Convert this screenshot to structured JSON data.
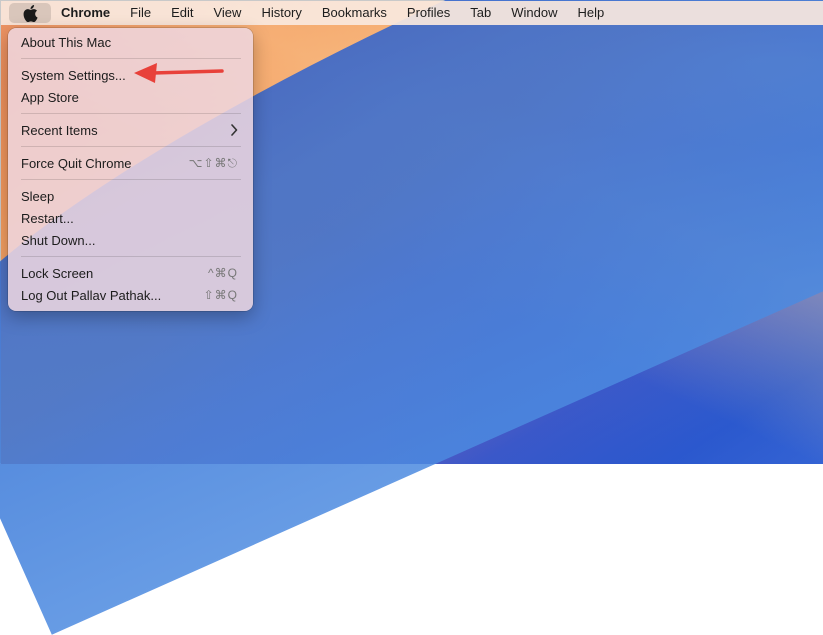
{
  "menubar": {
    "apple_icon": "apple-icon",
    "items": [
      "Chrome",
      "File",
      "Edit",
      "View",
      "History",
      "Bookmarks",
      "Profiles",
      "Tab",
      "Window",
      "Help"
    ]
  },
  "apple_menu": {
    "about": "About This Mac",
    "system_settings": "System Settings...",
    "app_store": "App Store",
    "recent_items": "Recent Items",
    "recent_items_icon": "chevron-right-icon",
    "force_quit": "Force Quit Chrome",
    "force_quit_shortcut": "⌥⇧⌘⎋",
    "sleep": "Sleep",
    "restart": "Restart...",
    "shut_down": "Shut Down...",
    "lock_screen": "Lock Screen",
    "lock_screen_shortcut": "^⌘Q",
    "log_out": "Log Out Pallav Pathak...",
    "log_out_shortcut": "⇧⌘Q"
  },
  "annotation": {
    "arrow_color": "#e8413a"
  }
}
